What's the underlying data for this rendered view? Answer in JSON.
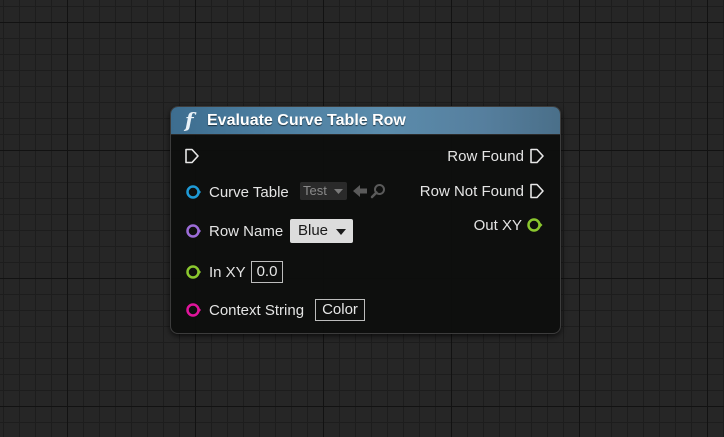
{
  "node": {
    "title": "Evaluate Curve Table Row",
    "function_icon": "function-icon",
    "header_color": "#4c7ea0"
  },
  "inputs": {
    "curve_table": {
      "label": "Curve Table",
      "value": "Test",
      "color": "#1e9ad6"
    },
    "row_name": {
      "label": "Row Name",
      "value": "Blue",
      "color": "#9c6cd8"
    },
    "in_xy": {
      "label": "In XY",
      "value": "0.0",
      "color": "#8ac72e"
    },
    "context_string": {
      "label": "Context String",
      "value": "Color",
      "color": "#e0159c"
    }
  },
  "outputs": {
    "row_found": {
      "label": "Row Found"
    },
    "row_not_found": {
      "label": "Row Not Found"
    },
    "out_xy": {
      "label": "Out XY",
      "color": "#8ac72e"
    }
  }
}
